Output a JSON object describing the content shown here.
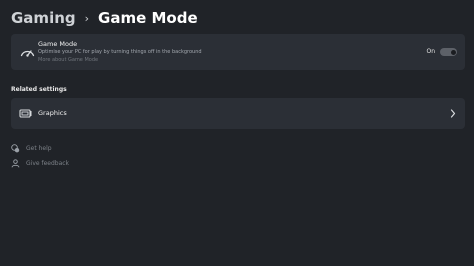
{
  "breadcrumb": {
    "parent": "Gaming",
    "separator": "›",
    "current": "Game Mode"
  },
  "game_mode": {
    "icon": "game-mode-icon",
    "title": "Game Mode",
    "description": "Optimise your PC for play by turning things off in the background",
    "link": "More about Game Mode",
    "toggle": {
      "state_label": "On",
      "is_on": true
    }
  },
  "related_settings": {
    "heading": "Related settings",
    "items": [
      {
        "label": "Graphics",
        "icon": "graphics-icon"
      }
    ]
  },
  "help_links": [
    {
      "label": "Get help",
      "icon": "help-icon"
    },
    {
      "label": "Give feedback",
      "icon": "feedback-icon"
    }
  ],
  "colors": {
    "background": "#202328",
    "card": "#2b2f36",
    "muted_text": "#7b8087"
  }
}
